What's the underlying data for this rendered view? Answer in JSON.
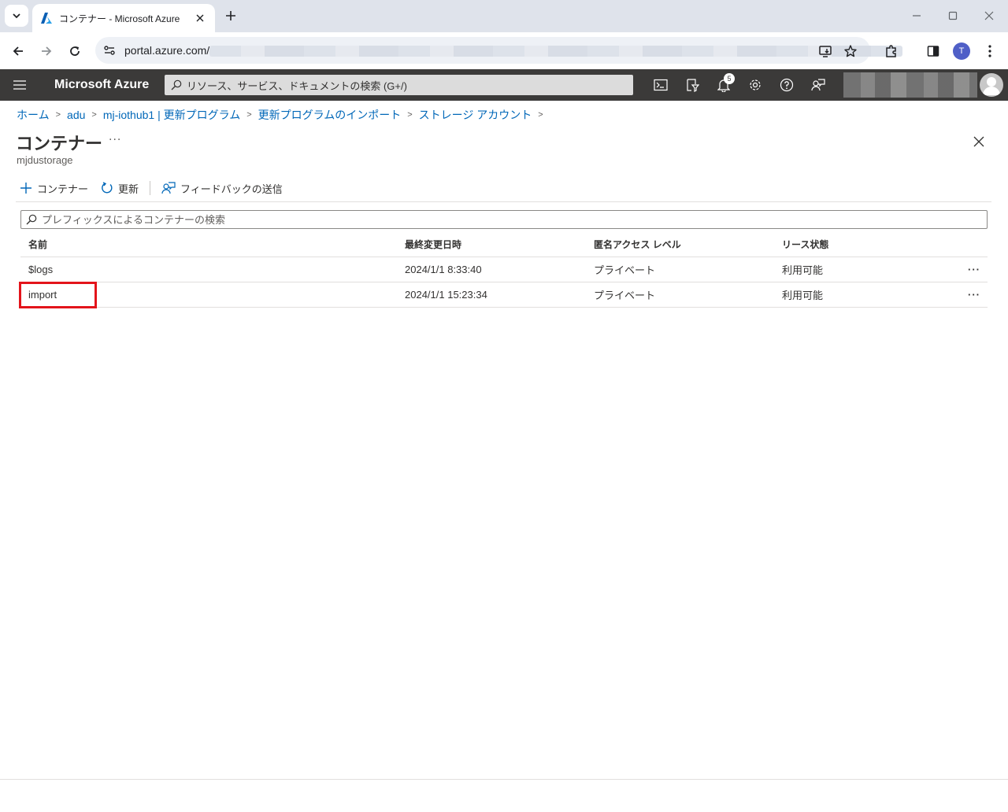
{
  "browser": {
    "tab_title": "コンテナー - Microsoft Azure",
    "url": "portal.azure.com/",
    "profile_initial": "T"
  },
  "azure": {
    "brand": "Microsoft Azure",
    "search_placeholder": "リソース、サービス、ドキュメントの検索 (G+/)",
    "notification_count": "5"
  },
  "breadcrumb": [
    "ホーム",
    "adu",
    "mj-iothub1 | 更新プログラム",
    "更新プログラムのインポート",
    "ストレージ アカウント"
  ],
  "page": {
    "title": "コンテナー",
    "subtitle": "mjdustorage",
    "more": "···"
  },
  "commands": {
    "add": "コンテナー",
    "refresh": "更新",
    "feedback": "フィードバックの送信"
  },
  "filter": {
    "placeholder": "プレフィックスによるコンテナーの検索"
  },
  "table": {
    "columns": [
      "名前",
      "最終変更日時",
      "匿名アクセス レベル",
      "リース状態"
    ],
    "rows": [
      {
        "name": "$logs",
        "modified": "2024/1/1 8:33:40",
        "access": "プライベート",
        "lease": "利用可能",
        "more": "···"
      },
      {
        "name": "import",
        "modified": "2024/1/1 15:23:34",
        "access": "プライベート",
        "lease": "利用可能",
        "more": "···"
      }
    ]
  },
  "colors": {
    "azure_bar": "#3b3a39",
    "link": "#0067b8",
    "highlight": "#e3141b"
  }
}
